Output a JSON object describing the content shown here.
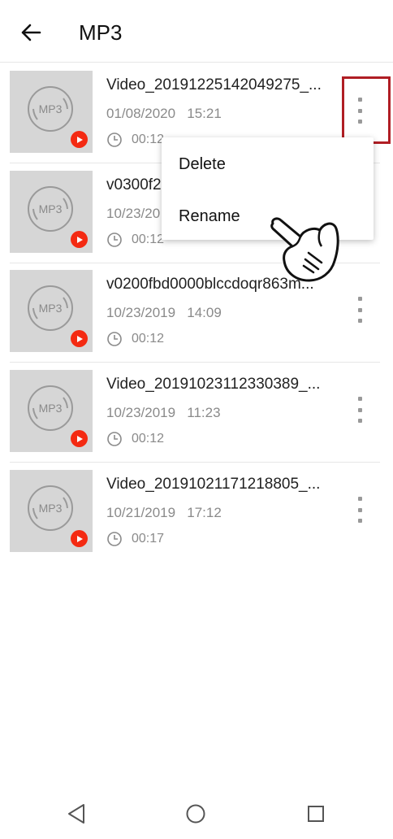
{
  "header": {
    "title": "MP3"
  },
  "files": [
    {
      "name": "Video_20191225142049275_...",
      "date": "01/08/2020",
      "time": "15:21",
      "duration": "00:12"
    },
    {
      "name": "v0300f2",
      "date": "10/23/20",
      "time": "",
      "duration": "00:12"
    },
    {
      "name": "v0200fbd0000blccdoqr863m...",
      "date": "10/23/2019",
      "time": "14:09",
      "duration": "00:12"
    },
    {
      "name": "Video_20191023112330389_...",
      "date": "10/23/2019",
      "time": "11:23",
      "duration": "00:12"
    },
    {
      "name": "Video_20191021171218805_...",
      "date": "10/21/2019",
      "time": "17:12",
      "duration": "00:17"
    }
  ],
  "thumb_label": "MP3",
  "menu": {
    "delete": "Delete",
    "rename": "Rename"
  },
  "colors": {
    "play": "#f42a12",
    "highlight": "#b01e24",
    "thumb_bg": "#d6d6d6"
  },
  "icons": [
    "back-arrow-icon",
    "more-vert-icon",
    "clock-icon",
    "play-icon",
    "disc-icon",
    "pointing-hand-icon",
    "nav-back-icon",
    "nav-home-icon",
    "nav-recents-icon"
  ]
}
